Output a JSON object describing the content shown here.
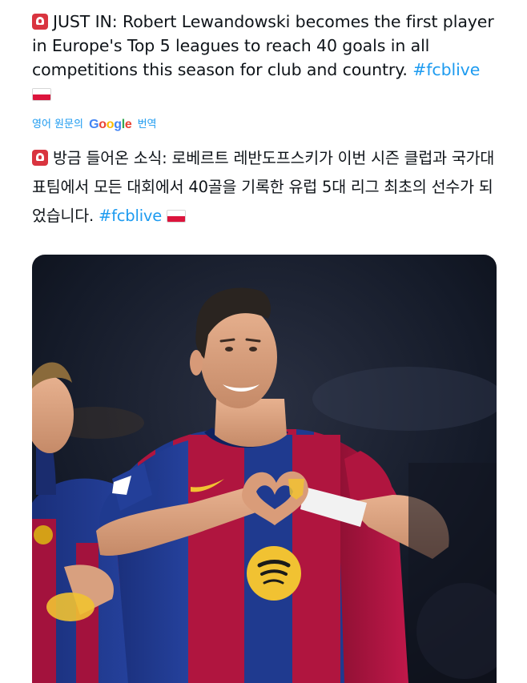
{
  "tweet": {
    "headline_prefix": "JUST IN: Robert Lewandowski becomes the first player in Europe's Top 5 leagues to reach 40 goals in all competitions this season for club and country.",
    "hashtag": "#fcblive",
    "siren_icon": "police-siren-emoji",
    "flag_icon": "poland-flag-emoji"
  },
  "translation": {
    "label_before": "영어 원문의",
    "google": [
      "G",
      "o",
      "o",
      "g",
      "l",
      "e"
    ],
    "label_after": "번역",
    "text": "방금 들어온 소식: 로베르트 레반도프스키가 이번 시즌 클럽과 국가대표팀에서 모든 대회에서 40골을 기록한 유럽 5대 리그 최초의 선수가 되었습니다.",
    "hashtag": "#fcblive"
  },
  "media": {
    "kind": "photo",
    "jersey_colors": {
      "blue": "#1f3a8f",
      "red": "#b0153f",
      "yellow": "#f1c232",
      "background": "#0f1422"
    }
  }
}
